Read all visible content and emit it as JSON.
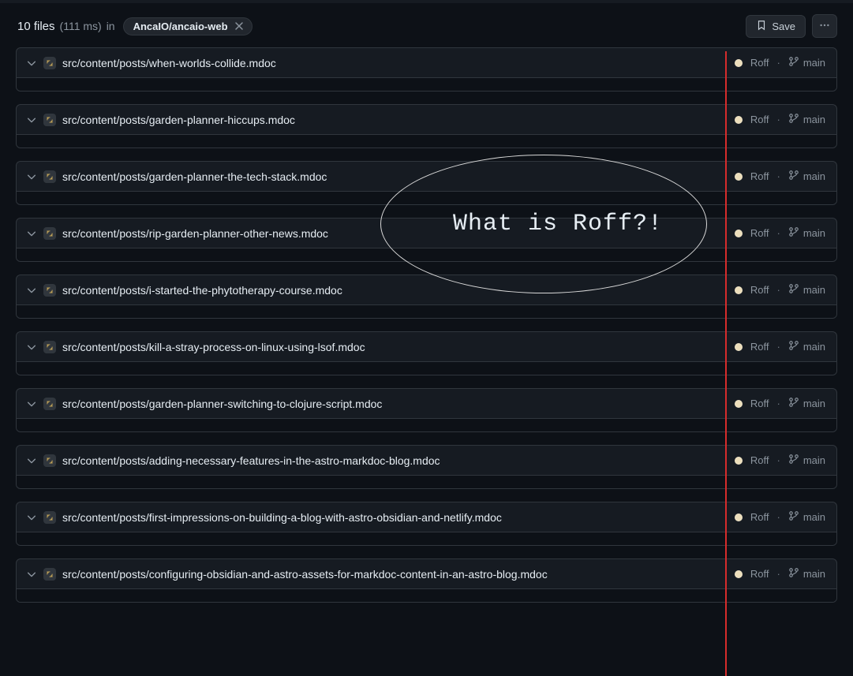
{
  "header": {
    "count_label": "10 files",
    "timing": "(111 ms)",
    "in_label": "in",
    "repo_chip": "AncaIO/ancaio-web",
    "save_label": "Save"
  },
  "result_meta": {
    "language": "Roff",
    "branch": "main",
    "separator": "·"
  },
  "results": [
    {
      "path": "src/content/posts/when-worlds-collide.mdoc"
    },
    {
      "path": "src/content/posts/garden-planner-hiccups.mdoc"
    },
    {
      "path": "src/content/posts/garden-planner-the-tech-stack.mdoc"
    },
    {
      "path": "src/content/posts/rip-garden-planner-other-news.mdoc"
    },
    {
      "path": "src/content/posts/i-started-the-phytotherapy-course.mdoc"
    },
    {
      "path": "src/content/posts/kill-a-stray-process-on-linux-using-lsof.mdoc"
    },
    {
      "path": "src/content/posts/garden-planner-switching-to-clojure-script.mdoc"
    },
    {
      "path": "src/content/posts/adding-necessary-features-in-the-astro-markdoc-blog.mdoc"
    },
    {
      "path": "src/content/posts/first-impressions-on-building-a-blog-with-astro-obsidian-and-netlify.mdoc"
    },
    {
      "path": "src/content/posts/configuring-obsidian-and-astro-assets-for-markdoc-content-in-an-astro-blog.mdoc"
    }
  ],
  "annotation": {
    "text": "What is Roff?!"
  }
}
